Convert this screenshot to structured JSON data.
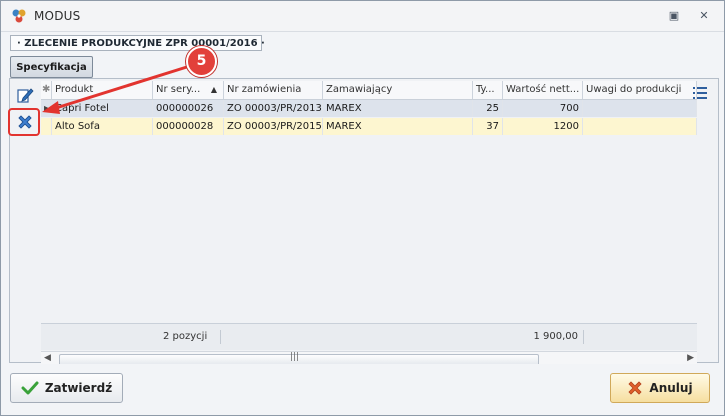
{
  "window": {
    "title": "MODUS",
    "restore_glyph": "▣",
    "close_glyph": "✕"
  },
  "document": {
    "header": "· ZLECENIE PRODUKCYJNE ZPR 00001/2016 ·"
  },
  "tabs": [
    {
      "label": "Specyfikacja",
      "active": true
    }
  ],
  "toolbar": {
    "edit_icon": "edit-icon",
    "delete_icon": "delete-icon"
  },
  "grid": {
    "columns": [
      "Produkt",
      "Nr sery...",
      "Nr zamówienia",
      "Zamawiający",
      "Ty...",
      "Wartość nett...",
      "Uwagi do produkcji"
    ],
    "sort_column": "Nr sery...",
    "rows": [
      {
        "produkt": "Capri Fotel",
        "nr_serii": "000000026",
        "nr_zamowienia": "ZO 00003/PR/2013",
        "zamawiajacy": "MAREX",
        "typ": "25",
        "wartosc": "700",
        "uwagi": ""
      },
      {
        "produkt": "Alto Sofa",
        "nr_serii": "000000028",
        "nr_zamowienia": "ZO 00003/PR/2015",
        "zamawiajacy": "MAREX",
        "typ": "37",
        "wartosc": "1200",
        "uwagi": ""
      }
    ],
    "footer": {
      "count": "2 pozycji",
      "total": "1 900,00"
    },
    "scroll_glyph": "|||"
  },
  "buttons": {
    "confirm": "Zatwierdź",
    "cancel": "Anuluj"
  },
  "annotation": {
    "step": "5"
  },
  "colors": {
    "accent_red": "#e2403a",
    "selected_row": "#dde3ec",
    "highlight_row": "#fdf6d0"
  }
}
